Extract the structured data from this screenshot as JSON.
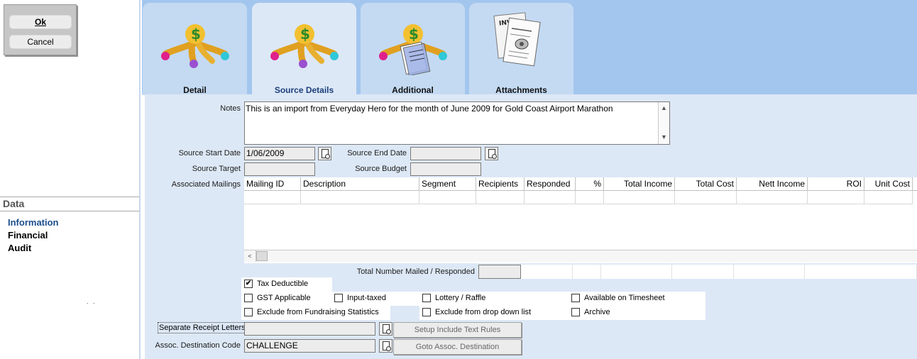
{
  "sidebar": {
    "ok_label": "Ok",
    "cancel_label": "Cancel",
    "data_header": "Data",
    "items": [
      {
        "label": "Information"
      },
      {
        "label": "Financial"
      },
      {
        "label": "Audit"
      }
    ],
    "dots": ". ."
  },
  "tabs": [
    {
      "label": "Detail",
      "icon": "dollar-fountain-icon"
    },
    {
      "label": "Source Details",
      "icon": "dollar-fountain-icon"
    },
    {
      "label": "Additional",
      "icon": "dollar-fountain-notepad-icon"
    },
    {
      "label": "Attachments",
      "icon": "documents-paperclip-icon"
    }
  ],
  "form": {
    "notes_label": "Notes",
    "notes_value": "This is an import from Everyday Hero for the month of June 2009 for Gold Coast Airport Marathon",
    "source_start_date_label": "Source Start Date",
    "source_start_date_value": "1/06/2009",
    "source_end_date_label": "Source End Date",
    "source_end_date_value": "",
    "source_target_label": "Source Target",
    "source_target_value": "",
    "source_budget_label": "Source Budget",
    "source_budget_value": "",
    "associated_mailings_label": "Associated Mailings",
    "total_mailed_label": "Total Number Mailed / Responded",
    "separate_receipt_label": "Separate Receipt Letters",
    "separate_receipt_value": "",
    "setup_include_label": "Setup Include Text Rules",
    "assoc_dest_label": "Assoc. Destination Code",
    "assoc_dest_value": "CHALLENGE",
    "goto_assoc_label": "Goto Assoc. Destination"
  },
  "mailings_table": {
    "columns": [
      "Mailing ID",
      "Description",
      "Segment",
      "Recipients",
      "Responded",
      "%",
      "Total Income",
      "Total Cost",
      "Nett Income",
      "ROI",
      "Unit Cost"
    ],
    "rows": []
  },
  "checkboxes": {
    "tax_deductible": {
      "label": "Tax Deductible",
      "checked": true
    },
    "gst_applicable": {
      "label": "GST Applicable",
      "checked": false
    },
    "input_taxed": {
      "label": "Input-taxed",
      "checked": false
    },
    "lottery_raffle": {
      "label": "Lottery / Raffle",
      "checked": false
    },
    "available_timesheet": {
      "label": "Available on Timesheet",
      "checked": false
    },
    "exclude_fundraising": {
      "label": "Exclude from Fundraising Statistics",
      "checked": false
    },
    "exclude_dropdown": {
      "label": "Exclude from drop down list",
      "checked": false
    },
    "archive": {
      "label": "Archive",
      "checked": false
    }
  },
  "colors": {
    "tab_strip": "#a3c6ee",
    "tab_active": "#dde8f6",
    "tab_inactive": "#c4daf2",
    "panel": "#dde8f6",
    "nav_active": "#1b4d8c"
  }
}
